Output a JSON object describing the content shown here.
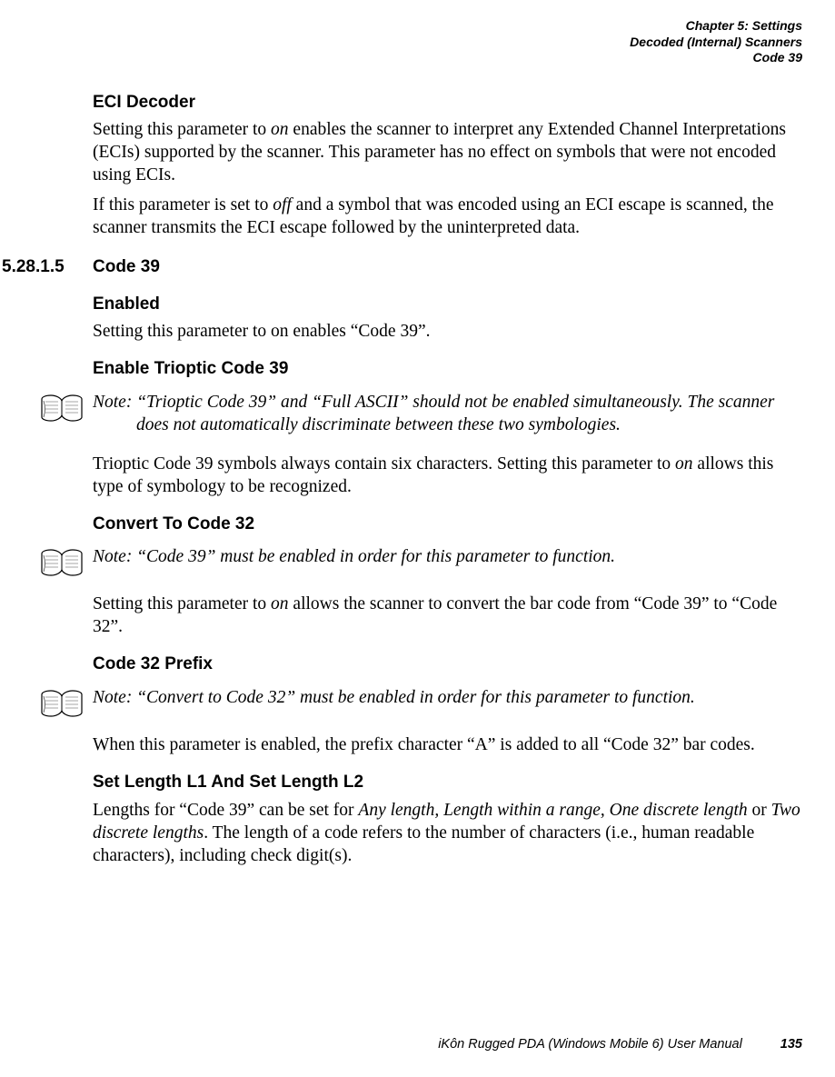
{
  "header": {
    "line1": "Chapter 5: Settings",
    "line2": "Decoded (Internal) Scanners",
    "line3": "Code 39"
  },
  "s_eci": {
    "title": "ECI Decoder",
    "p1a": "Setting this parameter to ",
    "p1b": "on",
    "p1c": " enables the scanner to interpret any Extended Channel Interpre­tations (ECIs) supported by the scanner. This parameter has no effect on symbols that were not encoded using ECIs.",
    "p2a": "If this parameter is set to ",
    "p2b": "off",
    "p2c": " and a symbol that was encoded using an ECI escape is scanned, the scanner transmits the ECI escape followed by the uninterpreted data."
  },
  "section": {
    "num": "5.28.1.5",
    "title": "Code 39"
  },
  "s_enabled": {
    "title": "Enabled",
    "p1": "Setting this parameter to on enables “Code 39”."
  },
  "s_trioptic": {
    "title": "Enable Trioptic Code 39",
    "note_label": "Note:",
    "note_body": "“Trioptic Code 39” and “Full ASCII” should not be enabled simultaneously. The scanner does not automatically discriminate between these two symbologies.",
    "p1a": "Trioptic Code 39 symbols always contain six characters. Setting this parameter to ",
    "p1b": "on",
    "p1c": " allows this type of symbology to be recognized."
  },
  "s_convert32": {
    "title": "Convert To Code 32",
    "note_label": "Note:",
    "note_body": "“Code 39” must be enabled in order for this parameter to function.",
    "p1a": "Setting this parameter to ",
    "p1b": "on",
    "p1c": " allows the scanner to convert the bar code from “Code 39” to “Code 32”."
  },
  "s_prefix": {
    "title": "Code 32 Prefix",
    "note_label": "Note:",
    "note_body": "“Convert to Code 32” must be enabled in order for this parameter to function.",
    "p1": "When this parameter is enabled, the prefix character “A” is added to all “Code 32” bar codes."
  },
  "s_length": {
    "title": "Set Length L1 And Set Length L2",
    "p1a": "Lengths for “Code 39” can be set for ",
    "p1b": "Any length, Length within a range, One discrete length",
    "p1c": " or ",
    "p1d": "Two discrete lengths",
    "p1e": ". The length of a code refers to the number of characters (i.e., human readable characters), including check digit(s)."
  },
  "footer": {
    "manual": "iKôn Rugged PDA (Windows Mobile 6) User Manual",
    "page": "135"
  }
}
